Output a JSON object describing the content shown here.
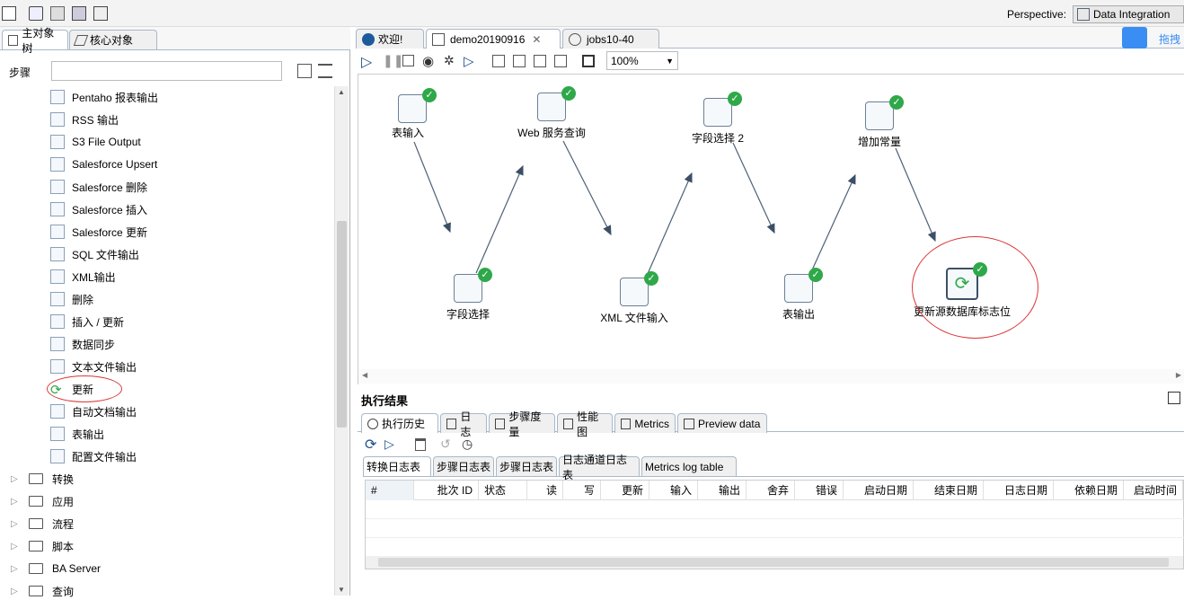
{
  "top_toolbar": {
    "perspective_label": "Perspective:",
    "perspective_value": "Data Integration",
    "drag_hint": "拖拽"
  },
  "left_panel": {
    "tabs": [
      "主对象树",
      "核心对象"
    ],
    "search_label": "步骤",
    "search_value": "",
    "steps": [
      "Pentaho 报表输出",
      "RSS 输出",
      "S3 File Output",
      "Salesforce Upsert",
      "Salesforce 删除",
      "Salesforce 插入",
      "Salesforce 更新",
      "SQL 文件输出",
      "XML输出",
      "删除",
      "插入 / 更新",
      "数据同步",
      "文本文件输出",
      "更新",
      "自动文档输出",
      "表输出",
      "配置文件输出"
    ],
    "folders": [
      "转换",
      "应用",
      "流程",
      "脚本",
      "BA Server",
      "查询"
    ]
  },
  "editor_tabs": [
    "欢迎!",
    "demo20190916",
    "jobs10-40"
  ],
  "canvas_toolbar": {
    "zoom": "100%"
  },
  "nodes": {
    "n1": "表输入",
    "n2": "字段选择",
    "n3": "Web 服务查询",
    "n4": "XML 文件输入",
    "n5": "字段选择 2",
    "n6": "表输出",
    "n7": "增加常量",
    "n8": "更新源数据库标志位"
  },
  "results": {
    "title": "执行结果",
    "tabs": [
      "执行历史",
      "日志",
      "步骤度量",
      "性能图",
      "Metrics",
      "Preview data"
    ],
    "log_tabs": [
      "转换日志表",
      "步骤日志表",
      "步骤日志表",
      "日志通道日志表",
      "Metrics log table"
    ],
    "columns": [
      "#",
      "批次 ID",
      "状态",
      "读",
      "写",
      "更新",
      "输入",
      "输出",
      "舍弃",
      "错误",
      "启动日期",
      "结束日期",
      "日志日期",
      "依赖日期",
      "启动时间"
    ]
  },
  "colors": {
    "accent": "#2fa84a",
    "highlight_circle": "#d9383a",
    "tab_active": "#ffffff"
  }
}
